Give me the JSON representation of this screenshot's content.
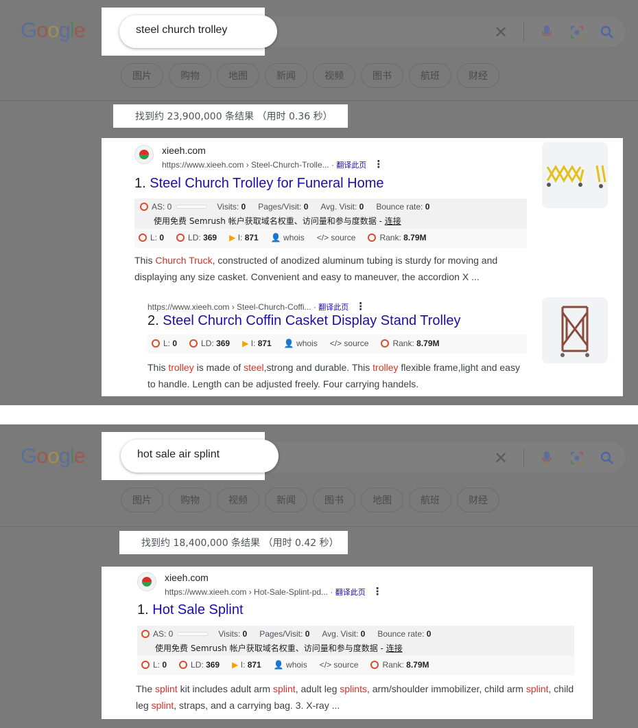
{
  "logo": "Google",
  "panel1": {
    "query": "steel church trolley",
    "tabs": [
      "图片",
      "购物",
      "地图",
      "新闻",
      "视频",
      "图书",
      "航班",
      "财经"
    ],
    "stats": "找到约 23,900,000 条结果 （用时 0.36 秒）",
    "site_name": "xieeh.com",
    "result1": {
      "url": "https://www.xieeh.com › Steel-Church-Trolle...",
      "translate": "翻译此页",
      "number": "1.",
      "title": "Steel Church Trolley for Funeral Home",
      "snippet_parts": [
        "This ",
        "Church Truck",
        ", constructed of anodized aluminum tubing is sturdy for moving and displaying any size casket. Convenient and easy to maneuver, the accordion X ..."
      ]
    },
    "result2": {
      "url": "https://www.xieeh.com › Steel-Church-Coffi...",
      "translate": "翻译此页",
      "number": "2.",
      "title": "Steel Church Coffin Casket Display Stand Trolley",
      "snippet_parts": [
        "This ",
        "trolley",
        " is made of ",
        "steel",
        ",strong and durable. This ",
        "trolley",
        " flexible frame,light and easy to handle. Length can be adjusted freely. Four carrying handels."
      ]
    }
  },
  "panel2": {
    "query": "hot sale air splint",
    "tabs": [
      "图片",
      "购物",
      "视频",
      "新闻",
      "图书",
      "地图",
      "航班",
      "财经"
    ],
    "stats": "找到约 18,400,000 条结果 （用时 0.42 秒）",
    "site_name": "xieeh.com",
    "result1": {
      "url": "https://www.xieeh.com › Hot-Sale-Splint-pd...",
      "translate": "翻译此页",
      "number": "1.",
      "title": "Hot Sale Splint",
      "snippet_parts": [
        "The ",
        "splint",
        " kit includes adult arm ",
        "splint",
        ", adult leg ",
        "splints",
        ", arm/shoulder immobilizer, child arm ",
        "splint",
        ", child leg ",
        "splint",
        ", straps, and a carrying bag. 3. X-ray ..."
      ]
    }
  },
  "seo": {
    "as_label": "AS: 0",
    "visits": "Visits:",
    "visits_val": "0",
    "pages": "Pages/Visit:",
    "pages_val": "0",
    "avg": "Avg. Visit:",
    "avg_val": "0",
    "bounce": "Bounce rate:",
    "bounce_val": "0",
    "semrush_text": "使用免费 Semrush 帐户获取域名权重、访问量和参与度数据 - ",
    "semrush_link": "连接",
    "l": "L:",
    "l_val": "0",
    "ld": "LD:",
    "ld_val": "369",
    "i": "I:",
    "i_val": "871",
    "whois": "whois",
    "source": "source",
    "rank": "Rank:",
    "rank_val": "8.79M"
  },
  "colors": {
    "accent_red": "#d93025",
    "link_blue": "#1a0dab",
    "seo_circle": "#d94c2e"
  }
}
